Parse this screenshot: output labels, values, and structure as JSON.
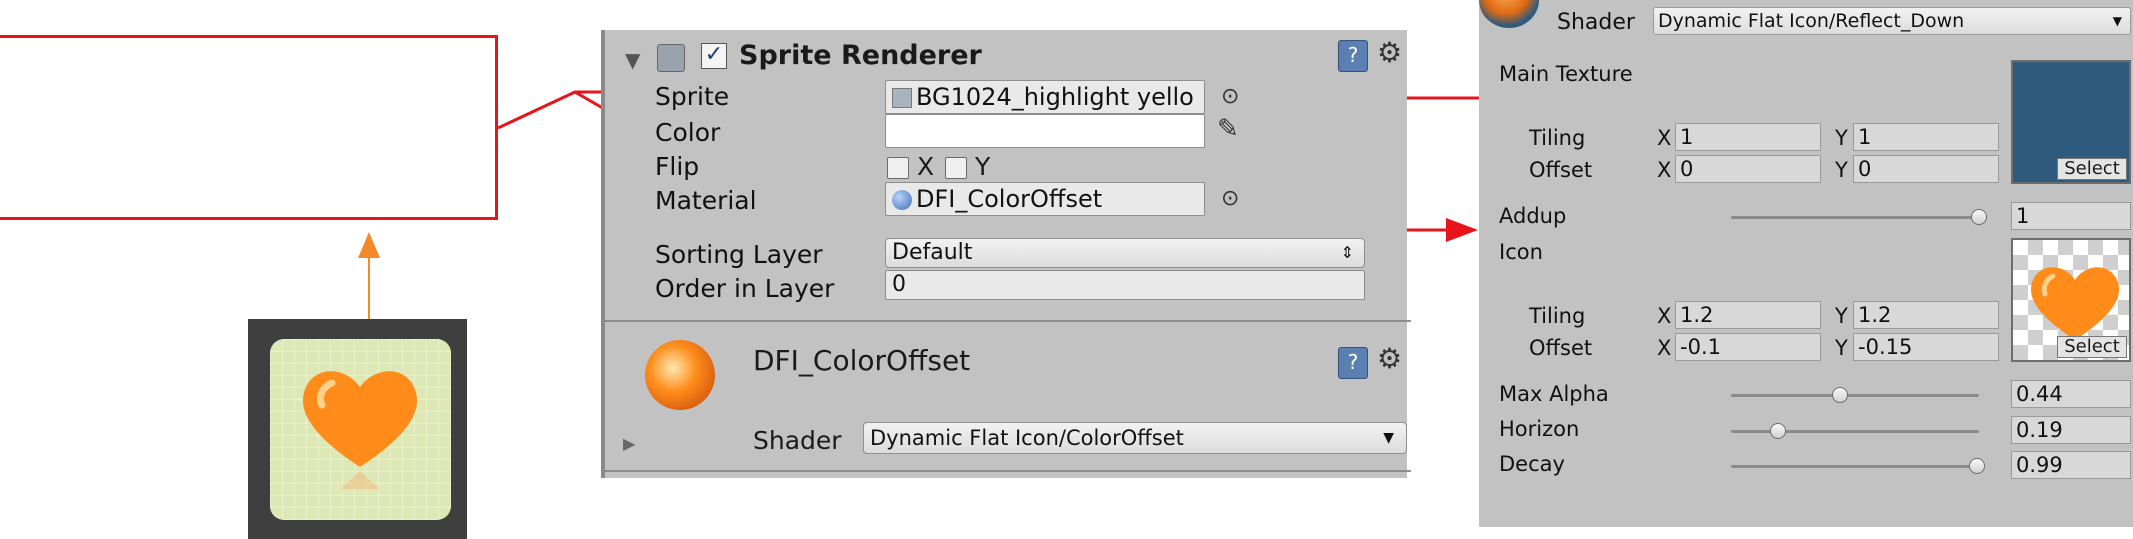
{
  "inspector": {
    "component_title": "Sprite Renderer",
    "sprite_label": "Sprite",
    "sprite_value": "BG1024_highlight yello",
    "color_label": "Color",
    "flip_label": "Flip",
    "flip_x": "X",
    "flip_y": "Y",
    "material_label": "Material",
    "material_value": "DFI_ColorOffset",
    "sorting_layer_label": "Sorting Layer",
    "sorting_layer_value": "Default",
    "order_label": "Order in Layer",
    "order_value": "0",
    "material_name": "DFI_ColorOffset",
    "shader_label": "Shader",
    "shader_value": "Dynamic Flat Icon/ColorOffset"
  },
  "material_panel": {
    "shader_label": "Shader",
    "shader_value": "Dynamic Flat Icon/Reflect_Down",
    "main_texture_label": "Main Texture",
    "tiling_label": "Tiling",
    "offset_label": "Offset",
    "x_label": "X",
    "y_label": "Y",
    "main_tiling_x": "1",
    "main_tiling_y": "1",
    "main_offset_x": "0",
    "main_offset_y": "0",
    "select_label": "Select",
    "addup_label": "Addup",
    "addup_value": "1",
    "addup_level": 1.0,
    "icon_label": "Icon",
    "icon_tiling_x": "1.2",
    "icon_tiling_y": "1.2",
    "icon_offset_x": "-0.1",
    "icon_offset_y": "-0.15",
    "max_alpha_label": "Max Alpha",
    "max_alpha_value": "0.44",
    "max_alpha_level": 0.44,
    "horizon_label": "Horizon",
    "horizon_value": "0.19",
    "horizon_level": 0.19,
    "decay_label": "Decay",
    "decay_value": "0.99",
    "decay_level": 0.99,
    "main_texture_color": "#2e5a7d"
  },
  "colors": {
    "annotation_red": "#e8141b",
    "arrow_orange": "#f28a2a",
    "heart_orange": "#ff8c1a"
  }
}
